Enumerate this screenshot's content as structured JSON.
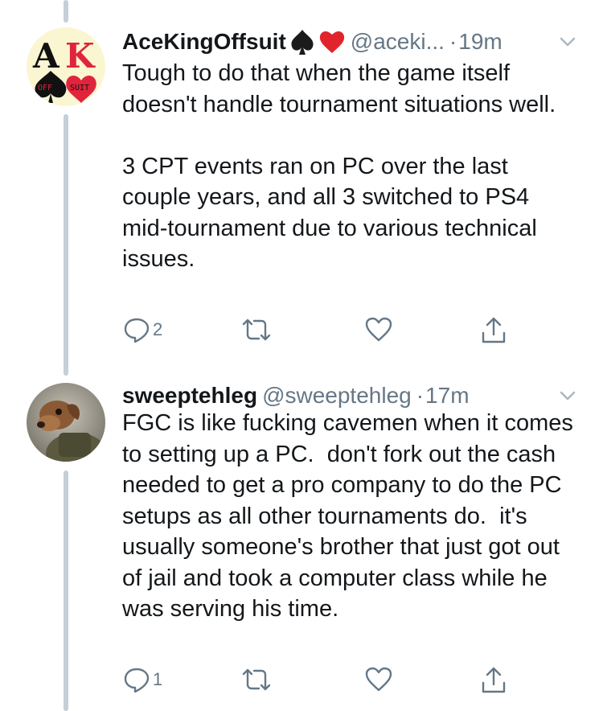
{
  "tweets": [
    {
      "display_name": "AceKingOffsuit",
      "handle": "@aceki...",
      "time": "19m",
      "avatar_text": {
        "left": "A",
        "right": "K",
        "off": "OFF",
        "suit": "SUIT"
      },
      "body": "Tough to do that when the game itself doesn't handle tournament situations well.\n\n3 CPT events ran on PC over the last couple years, and all 3 switched to PS4 mid-tournament due to various technical issues.",
      "reply_count": "2"
    },
    {
      "display_name": "sweeptehleg",
      "handle": "@sweeptehleg",
      "time": "17m",
      "body": "FGC is like fucking cavemen when it comes to setting up a PC.  don't fork out the cash needed to get a pro company to do the PC setups as all other tournaments do.  it's usually someone's brother that just got out of jail and took a computer class while he was serving his time.",
      "reply_count": "1"
    }
  ],
  "icons": {
    "reply": "reply-icon",
    "retweet": "retweet-icon",
    "like": "heart-icon",
    "share": "share-icon",
    "chevron": "chevron-down-icon",
    "spade": "spade-emoji",
    "heart": "heart-emoji"
  },
  "colors": {
    "text": "#14171a",
    "secondary": "#657786",
    "thread": "#c4cfd6",
    "ak_red": "#e0243c",
    "avatar_bg": "#fbf6d2"
  }
}
